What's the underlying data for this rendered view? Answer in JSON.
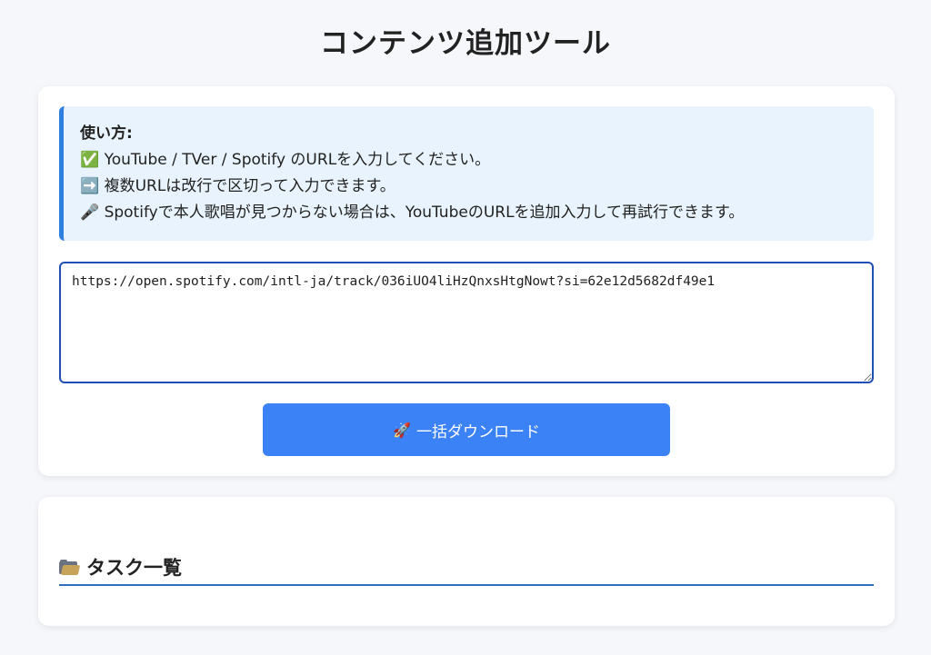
{
  "header": {
    "title": "コンテンツ追加ツール"
  },
  "instructions": {
    "heading": "使い方:",
    "lines": [
      "✅ YouTube / TVer / Spotify のURLを入力してください。",
      "➡️ 複数URLは改行で区切って入力できます。",
      "🎤 Spotifyで本人歌唱が見つからない場合は、YouTubeのURLを追加入力して再試行できます。"
    ]
  },
  "url_input": {
    "value": "https://open.spotify.com/intl-ja/track/036iUO4liHzQnxsHtgNowt?si=62e12d5682df49e1"
  },
  "download_button": {
    "icon": "🚀",
    "label": "一括ダウンロード"
  },
  "tasks": {
    "heading": "タスク一覧",
    "icon": "folder-icon"
  },
  "colors": {
    "background": "#f5f7fa",
    "info_bg": "#e8f3fd",
    "info_accent": "#2f7fe0",
    "button_bg": "#3b82f6",
    "textarea_border": "#1f4fb4"
  }
}
